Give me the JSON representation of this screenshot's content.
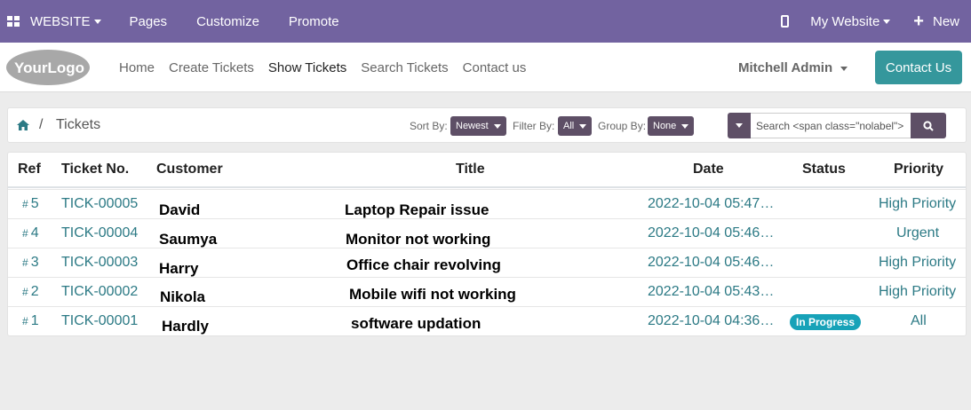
{
  "topbar": {
    "website_label": "WEBSITE",
    "pages_label": "Pages",
    "customize_label": "Customize",
    "promote_label": "Promote",
    "my_website_label": "My Website",
    "new_label": "New",
    "color": "#7263a0"
  },
  "navbar": {
    "logo_text": "YourLogo",
    "links": [
      "Home",
      "Create Tickets",
      "Show Tickets",
      "Search Tickets",
      "Contact us"
    ],
    "active_link": "Show Tickets",
    "user_name": "Mitchell Admin",
    "contact_button": "Contact Us",
    "accent": "#35979c"
  },
  "breadcrumb": {
    "title": "Tickets",
    "separator": "/"
  },
  "filters": {
    "sort_label": "Sort By:",
    "sort_value": "Newest",
    "filter_label": "Filter By:",
    "filter_value": "All",
    "group_label": "Group By:",
    "group_value": "None",
    "search_placeholder": "Search <span class=\"nolabel\">"
  },
  "table": {
    "headers": [
      "Ref",
      "Ticket No.",
      "Customer",
      "Title",
      "Date",
      "Status",
      "Priority"
    ],
    "rows": [
      {
        "ref": "5",
        "ticket": "TICK-00005",
        "customer": "David",
        "title": "Laptop Repair issue",
        "date": "2022-10-04 05:47…",
        "status": "",
        "priority": "High Priority"
      },
      {
        "ref": "4",
        "ticket": "TICK-00004",
        "customer": "Saumya",
        "title": "Monitor not working",
        "date": "2022-10-04 05:46…",
        "status": "",
        "priority": "Urgent"
      },
      {
        "ref": "3",
        "ticket": "TICK-00003",
        "customer": "Harry",
        "title": "Office chair revolving",
        "date": "2022-10-04 05:46…",
        "status": "",
        "priority": "High Priority"
      },
      {
        "ref": "2",
        "ticket": "TICK-00002",
        "customer": "Nikola",
        "title": "Mobile wifi not working",
        "date": "2022-10-04 05:43…",
        "status": "",
        "priority": "High Priority"
      },
      {
        "ref": "1",
        "ticket": "TICK-00001",
        "customer": "Hardly",
        "title": "software updation",
        "date": "2022-10-04 04:36…",
        "status": "In Progress",
        "priority": "All"
      }
    ],
    "ref_prefix": "#"
  }
}
